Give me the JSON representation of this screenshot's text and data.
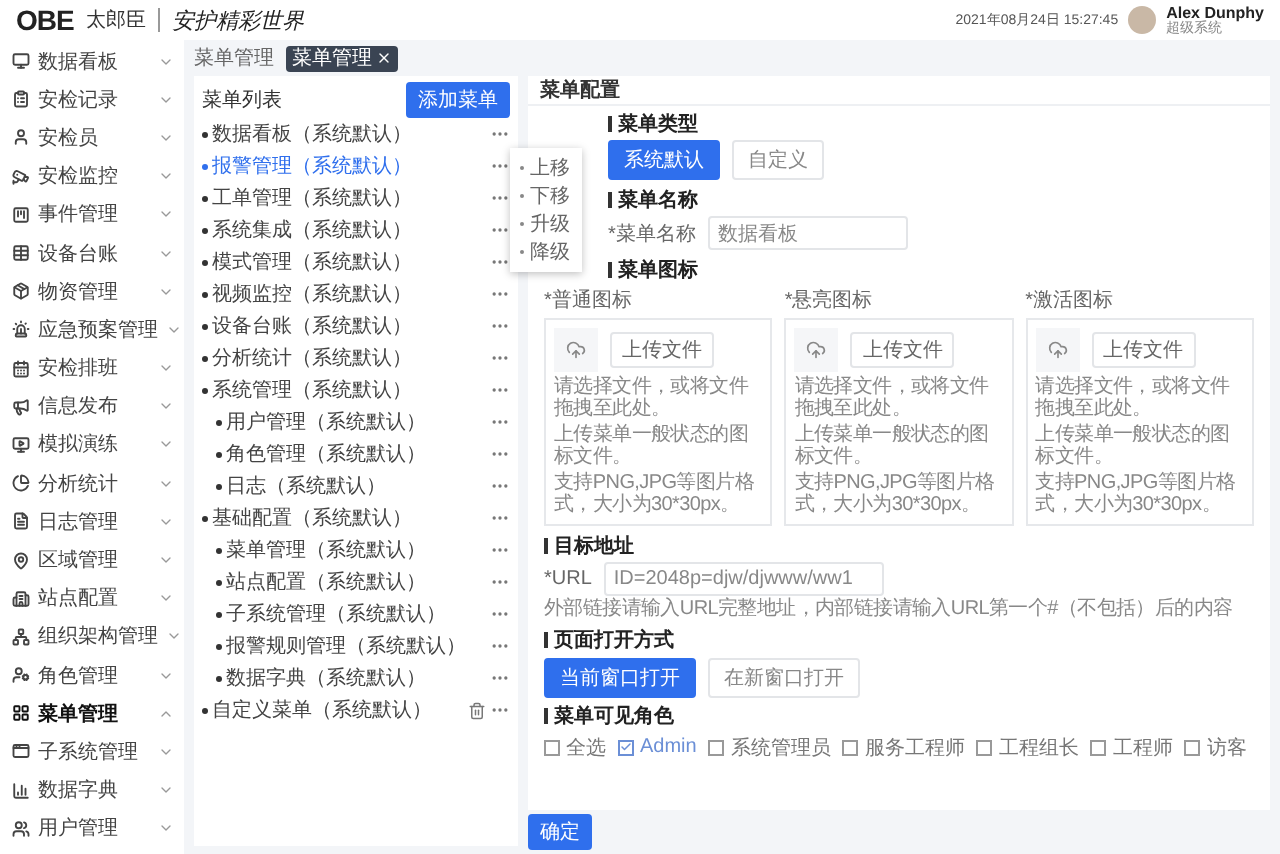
{
  "header": {
    "logo": "OBE",
    "logo_sub": "太郎臣",
    "slogan": "安护精彩世界",
    "datetime": "2021年08月24日 15:27:45",
    "user_name": "Alex Dunphy",
    "user_role": "超级系统"
  },
  "sidebar": {
    "items": [
      {
        "label": "数据看板",
        "selected": false,
        "expanded": false
      },
      {
        "label": "安检记录",
        "selected": false,
        "expanded": false
      },
      {
        "label": "安检员",
        "selected": false,
        "expanded": false
      },
      {
        "label": "安检监控",
        "selected": false,
        "expanded": false
      },
      {
        "label": "事件管理",
        "selected": false,
        "expanded": false
      },
      {
        "label": "设备台账",
        "selected": false,
        "expanded": false
      },
      {
        "label": "物资管理",
        "selected": false,
        "expanded": false
      },
      {
        "label": "应急预案管理",
        "selected": false,
        "expanded": false
      },
      {
        "label": "安检排班",
        "selected": false,
        "expanded": false
      },
      {
        "label": "信息发布",
        "selected": false,
        "expanded": false
      },
      {
        "label": "模拟演练",
        "selected": false,
        "expanded": false
      },
      {
        "label": "分析统计",
        "selected": false,
        "expanded": false
      },
      {
        "label": "日志管理",
        "selected": false,
        "expanded": false
      },
      {
        "label": "区域管理",
        "selected": false,
        "expanded": false
      },
      {
        "label": "站点配置",
        "selected": false,
        "expanded": false
      },
      {
        "label": "组织架构管理",
        "selected": false,
        "expanded": false
      },
      {
        "label": "角色管理",
        "selected": false,
        "expanded": false
      },
      {
        "label": "菜单管理",
        "selected": true,
        "expanded": true
      },
      {
        "label": "子系统管理",
        "selected": false,
        "expanded": false
      },
      {
        "label": "数据字典",
        "selected": false,
        "expanded": false
      },
      {
        "label": "用户管理",
        "selected": false,
        "expanded": false
      }
    ]
  },
  "breadcrumb": "菜单管理",
  "open_tabs": [
    {
      "label": "菜单管理",
      "selected": true
    }
  ],
  "menu_list": {
    "title": "菜单列表",
    "add_button": "添加菜单",
    "items": [
      {
        "label": "数据看板（系统默认）",
        "selected": false,
        "removable": false
      },
      {
        "label": "报警管理（系统默认）",
        "selected": true,
        "removable": false
      },
      {
        "label": "工单管理（系统默认）",
        "selected": false,
        "removable": false
      },
      {
        "label": "系统集成（系统默认）",
        "selected": false,
        "removable": false
      },
      {
        "label": "模式管理（系统默认）",
        "selected": false,
        "removable": false
      },
      {
        "label": "视频监控（系统默认）",
        "selected": false,
        "removable": false
      },
      {
        "label": "设备台账（系统默认）",
        "selected": false,
        "removable": false
      },
      {
        "label": "分析统计（系统默认）",
        "selected": false,
        "removable": false
      },
      {
        "label": "系统管理（系统默认）",
        "selected": false,
        "removable": false,
        "children": [
          {
            "label": "用户管理（系统默认）",
            "selected": false,
            "removable": false
          },
          {
            "label": "角色管理（系统默认）",
            "selected": false,
            "removable": false
          },
          {
            "label": "日志（系统默认）",
            "selected": false,
            "removable": false
          }
        ]
      },
      {
        "label": "基础配置（系统默认）",
        "selected": false,
        "removable": false,
        "children": [
          {
            "label": "菜单管理（系统默认）",
            "selected": false,
            "removable": false
          },
          {
            "label": "站点配置（系统默认）",
            "selected": false,
            "removable": false
          },
          {
            "label": "子系统管理（系统默认）",
            "selected": false,
            "removable": false
          },
          {
            "label": "报警规则管理（系统默认）",
            "selected": false,
            "removable": false
          },
          {
            "label": "数据字典（系统默认）",
            "selected": false,
            "removable": false
          }
        ]
      },
      {
        "label": "自定义菜单（系统默认）",
        "selected": false,
        "removable": true
      }
    ]
  },
  "context_menu": {
    "items": [
      "上移",
      "下移",
      "升级",
      "降级"
    ]
  },
  "config": {
    "title": "菜单配置",
    "menu_type": {
      "heading": "菜单类型",
      "options": [
        {
          "label": "系统默认",
          "selected": true
        },
        {
          "label": "自定义",
          "selected": false
        }
      ]
    },
    "menu_name": {
      "heading": "菜单名称",
      "label": "*菜单名称",
      "value": "数据看板"
    },
    "menu_icons": {
      "heading": "菜单图标",
      "uploads": [
        {
          "label": "*普通图标",
          "button": "上传文件",
          "hints": [
            "请选择文件，或将文件拖拽至此处。",
            "上传菜单一般状态的图标文件。",
            "支持PNG,JPG等图片格式，大小为30*30px。"
          ]
        },
        {
          "label": "*悬亮图标",
          "button": "上传文件",
          "hints": [
            "请选择文件，或将文件拖拽至此处。",
            "上传菜单一般状态的图标文件。",
            "支持PNG,JPG等图片格式，大小为30*30px。"
          ]
        },
        {
          "label": "*激活图标",
          "button": "上传文件",
          "hints": [
            "请选择文件，或将文件拖拽至此处。",
            "上传菜单一般状态的图标文件。",
            "支持PNG,JPG等图片格式，大小为30*30px。"
          ]
        }
      ]
    },
    "target": {
      "heading": "目标地址",
      "label": "*URL",
      "value": "ID=2048p=djw/djwww/ww1",
      "hint": "外部链接请输入URL完整地址，内部链接请输入URL第一个#（不包括）后的内容"
    },
    "open_mode": {
      "heading": "页面打开方式",
      "options": [
        {
          "label": "当前窗口打开",
          "selected": true
        },
        {
          "label": "在新窗口打开",
          "selected": false
        }
      ]
    },
    "roles": {
      "heading": "菜单可见角色",
      "options": [
        {
          "label": "全选",
          "checked": false
        },
        {
          "label": "Admin",
          "checked": true
        },
        {
          "label": "系统管理员",
          "checked": false
        },
        {
          "label": "服务工程师",
          "checked": false
        },
        {
          "label": "工程组长",
          "checked": false
        },
        {
          "label": "工程师",
          "checked": false
        },
        {
          "label": "访客",
          "checked": false
        }
      ]
    }
  },
  "confirm_button": "确定"
}
